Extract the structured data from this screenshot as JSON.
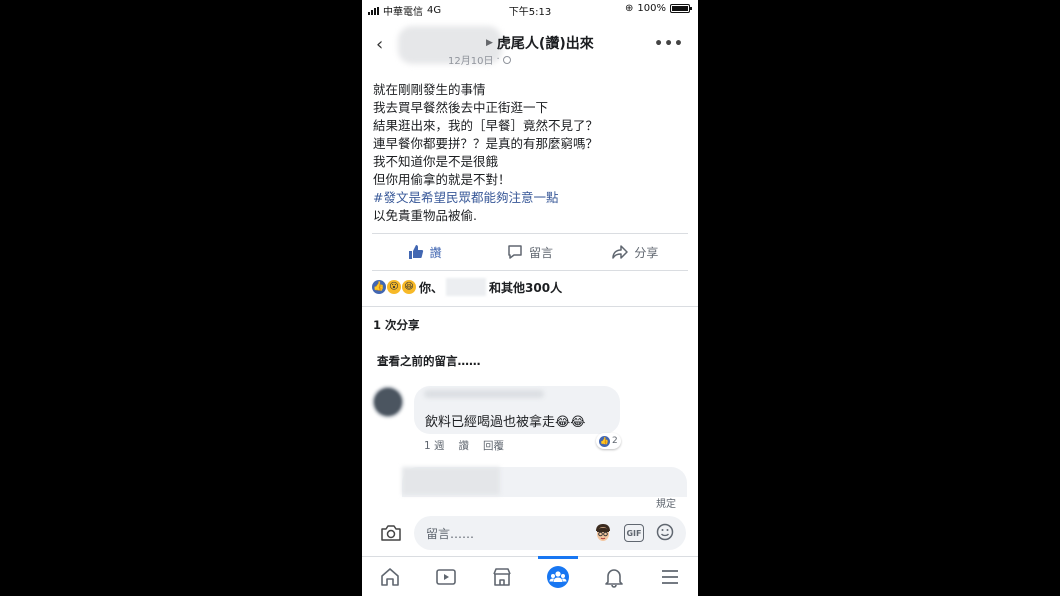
{
  "status_bar": {
    "carrier": "中華電信",
    "network": "4G",
    "time": "下午5:13",
    "battery": "100%"
  },
  "header": {
    "title": "虎尾人(讚)出來",
    "date": "12月10日",
    "dot": "·"
  },
  "post": {
    "lines": [
      "就在剛剛發生的事情",
      "我去買早餐然後去中正街逛一下",
      "結果逛出來，我的［早餐］竟然不見了？",
      "連早餐你都要拼？？是真的有那麼窮嗎？",
      "我不知道你是不是很餓",
      "但你用偷拿的就是不對！",
      "#發文是希望民眾都能夠注意一點",
      "以免貴重物品被偷."
    ]
  },
  "actions": {
    "like": "讚",
    "comment": "留言",
    "share": "分享"
  },
  "reactions": {
    "you": "你、",
    "others": "和其他300人"
  },
  "shares": "1 次分享",
  "view_previous": "查看之前的留言……",
  "comment": {
    "text": "飲料已經喝過也被拿走😂😂",
    "time": "1 週",
    "like": "讚",
    "reply": "回覆",
    "reaction_count": "2"
  },
  "rule": "規定",
  "compose": {
    "placeholder": "留言……",
    "gif": "GIF"
  },
  "colors": {
    "accent": "#1877f2",
    "like_blue": "#4267b2",
    "hashtag": "#385898"
  },
  "nav": [
    "home-icon",
    "video-icon",
    "marketplace-icon",
    "groups-icon",
    "bell-icon",
    "menu-icon"
  ]
}
